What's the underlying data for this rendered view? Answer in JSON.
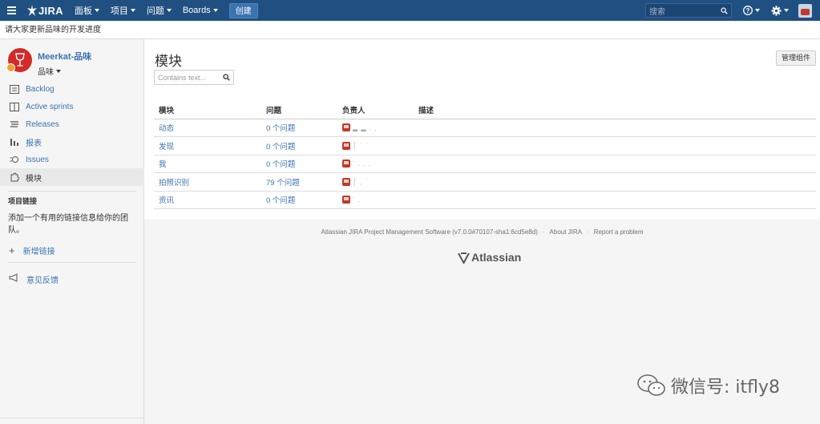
{
  "topnav": {
    "logo_text": "JIRA",
    "menu": [
      "面板",
      "项目",
      "问题",
      "Boards"
    ],
    "create_label": "创建",
    "search_placeholder": "搜索"
  },
  "announcement": "请大家更新品味的开发进度",
  "project": {
    "name": "Meerkat-品味",
    "subtitle": "品味"
  },
  "sidebar": {
    "items": [
      {
        "label": "Backlog",
        "icon": "backlog-icon"
      },
      {
        "label": "Active sprints",
        "icon": "sprints-icon"
      },
      {
        "label": "Releases",
        "icon": "releases-icon"
      },
      {
        "label": "报表",
        "icon": "reports-icon"
      },
      {
        "label": "Issues",
        "icon": "issues-icon"
      },
      {
        "label": "模块",
        "icon": "components-icon",
        "active": true
      }
    ],
    "section_title": "项目链接",
    "section_desc": "添加一个有用的链接信息给你的团队。",
    "add_link_label": "新增链接",
    "feedback_label": "意见反馈"
  },
  "main": {
    "title": "模块",
    "filter_placeholder": "Contains text...",
    "manage_button": "管理组件",
    "table": {
      "headers": [
        "模块",
        "问题",
        "负责人",
        "描述"
      ],
      "rows": [
        {
          "name": "动态",
          "issues": "0 个问题",
          "lead": "▂ ▂ . ˎ"
        },
        {
          "name": "发现",
          "issues": "0 个问题",
          "lead": "│ ˙ ˙"
        },
        {
          "name": "我",
          "issues": "0 个问题",
          "lead": "˙ . . ."
        },
        {
          "name": "拍照识别",
          "issues": "79 个问题",
          "lead": "│ ˎ ˙"
        },
        {
          "name": "资讯",
          "issues": "0 个问题",
          "lead": "˙ ."
        }
      ]
    }
  },
  "footer": {
    "software": "Atlassian JIRA Project Management Software (v7.0.0#70107-sha1:6cd5e8d)",
    "about": "About JIRA",
    "report": "Report a problem",
    "atlassian": "Atlassian"
  },
  "watermark": "微信号: itfly8",
  "colors": {
    "nav": "#205081",
    "link": "#3b73af",
    "project_avatar": "#d42a2a"
  }
}
